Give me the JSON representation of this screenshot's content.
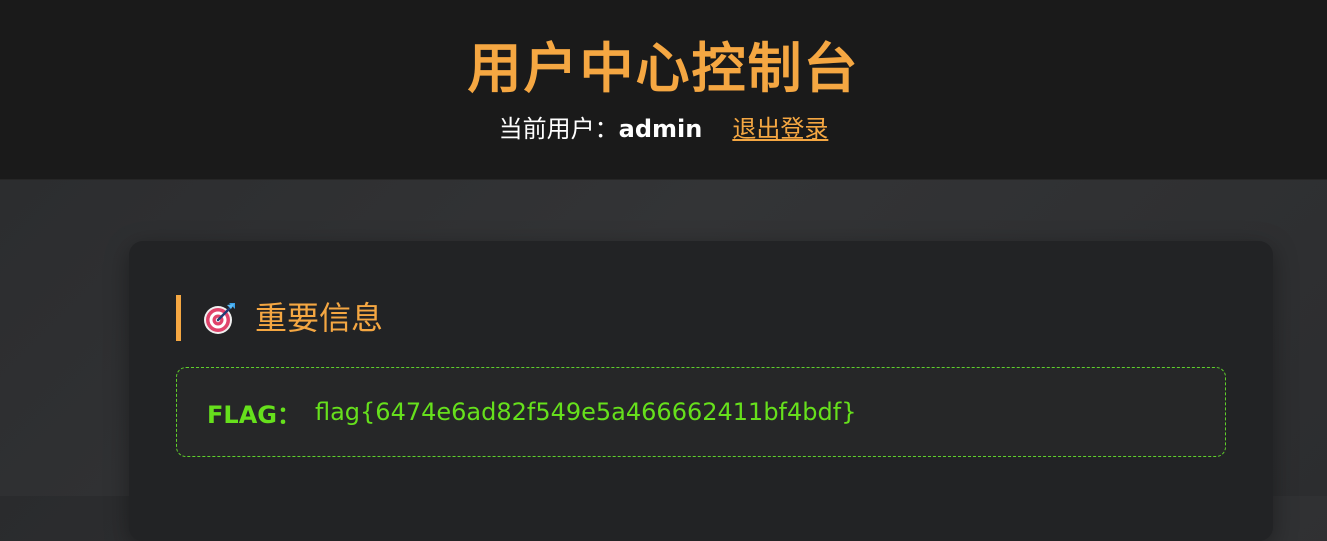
{
  "header": {
    "title": "用户中心控制台",
    "user_label": "当前用户：",
    "username": "admin",
    "logout_label": "退出登录"
  },
  "card": {
    "section_icon": "target-dart-icon",
    "section_title": "重要信息",
    "flag_label": "FLAG：",
    "flag_value": "flag{6474e6ad82f549e5a466662411bf4bdf}"
  },
  "colors": {
    "accent": "#f5a742",
    "flag_green": "#66e01c",
    "header_bg": "#1a1a1a",
    "card_bg": "#222325"
  }
}
